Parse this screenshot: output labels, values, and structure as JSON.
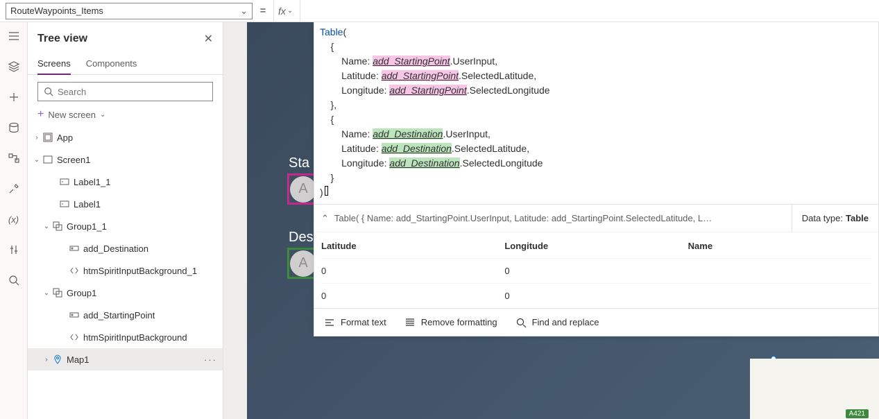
{
  "topbar": {
    "propertyName": "RouteWaypoints_Items",
    "equals": "=",
    "fx": "fx"
  },
  "treeView": {
    "title": "Tree view",
    "tabs": {
      "screens": "Screens",
      "components": "Components"
    },
    "searchPlaceholder": "Search",
    "newScreen": "New screen",
    "nodes": {
      "app": "App",
      "screen1": "Screen1",
      "label1_1": "Label1_1",
      "label1": "Label1",
      "group1_1": "Group1_1",
      "add_destination": "add_Destination",
      "htmBg1": "htmSpiritInputBackground_1",
      "group1": "Group1",
      "add_starting": "add_StartingPoint",
      "htmBg": "htmSpiritInputBackground",
      "map1": "Map1"
    },
    "more": "···"
  },
  "canvas": {
    "startLabel": "Sta",
    "destLabel": "Des",
    "placeholderA": "A"
  },
  "code": {
    "fn": "Table",
    "open": "(",
    "l2": "    {",
    "l3a": "        Name: ",
    "id1": "add_StartingPoint",
    "l3b": ".UserInput,",
    "l4a": "        Latitude: ",
    "l4b": ".SelectedLatitude,",
    "l5a": "        Longitude: ",
    "l5b": ".SelectedLongitude",
    "l6": "    },",
    "l7": "    {",
    "id2": "add_Destination",
    "l11": "    }",
    "close": ")"
  },
  "result": {
    "summary": "Table( { Name: add_StartingPoint.UserInput, Latitude: add_StartingPoint.SelectedLatitude, L…",
    "typeLabel": "Data type: ",
    "typeValue": "Table",
    "columns": {
      "latitude": "Latitude",
      "longitude": "Longitude",
      "name": "Name"
    },
    "rows": [
      {
        "lat": "0",
        "lon": "0",
        "name": ""
      },
      {
        "lat": "0",
        "lon": "0",
        "name": ""
      }
    ]
  },
  "foot": {
    "format": "Format text",
    "remove": "Remove formatting",
    "find": "Find and replace"
  },
  "map": {
    "road": "A421"
  }
}
